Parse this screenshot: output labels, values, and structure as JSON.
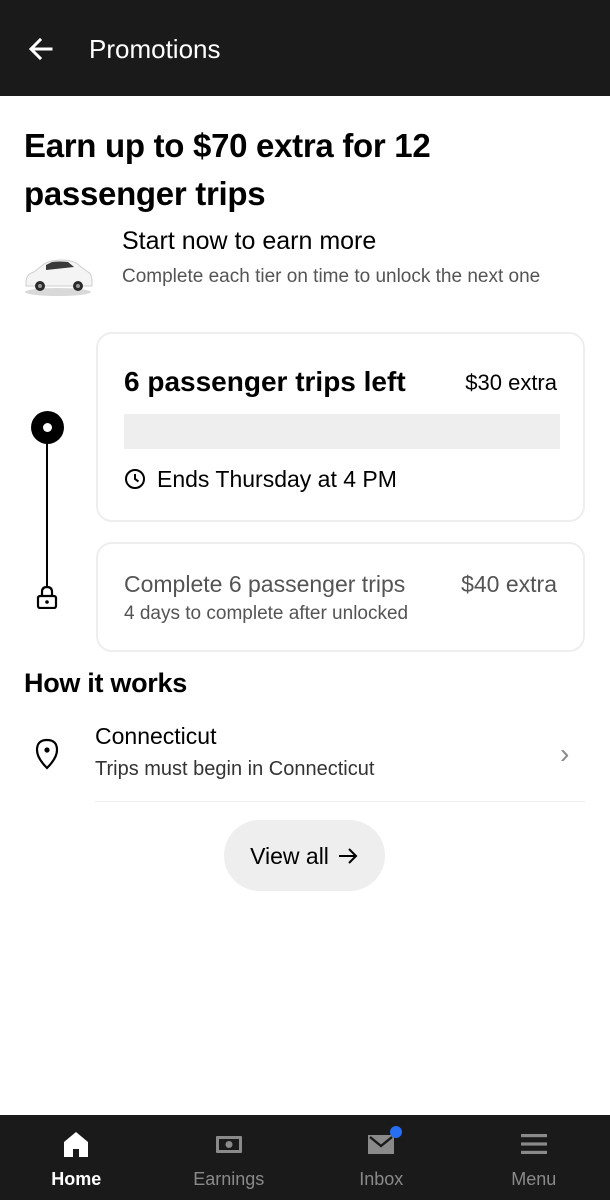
{
  "header": {
    "title": "Promotions",
    "back_icon": "arrow-left-icon"
  },
  "promo": {
    "headline": "Earn up to $70 extra for 12 passenger trips",
    "start_title": "Start now to earn more",
    "start_subtitle": "Complete each tier on time to unlock the next one",
    "vehicle_icon": "car-image"
  },
  "tiers": [
    {
      "title": "6 passenger trips left",
      "amount": "$30 extra",
      "progress_fraction": 0,
      "ends": "Ends Thursday at 4 PM",
      "status": "active"
    },
    {
      "title": "Complete 6 passenger trips",
      "amount": "$40 extra",
      "subtitle": "4 days to complete after unlocked",
      "status": "locked"
    }
  ],
  "how_it_works": {
    "title": "How it works",
    "items": [
      {
        "title": "Connecticut",
        "subtitle": "Trips must begin in Connecticut",
        "icon": "location-pin-icon"
      }
    ],
    "view_all_label": "View all"
  },
  "bottom_nav": {
    "items": [
      {
        "label": "Home",
        "icon": "home-icon",
        "active": true
      },
      {
        "label": "Earnings",
        "icon": "earnings-icon",
        "active": false
      },
      {
        "label": "Inbox",
        "icon": "inbox-icon",
        "active": false,
        "has_badge": true
      },
      {
        "label": "Menu",
        "icon": "menu-icon",
        "active": false
      }
    ]
  },
  "colors": {
    "header_bg": "#1a1a1a",
    "nav_bg": "#1a1a1a",
    "badge": "#276ef1",
    "muted_text": "#545454",
    "card_border": "#eeeeee"
  }
}
